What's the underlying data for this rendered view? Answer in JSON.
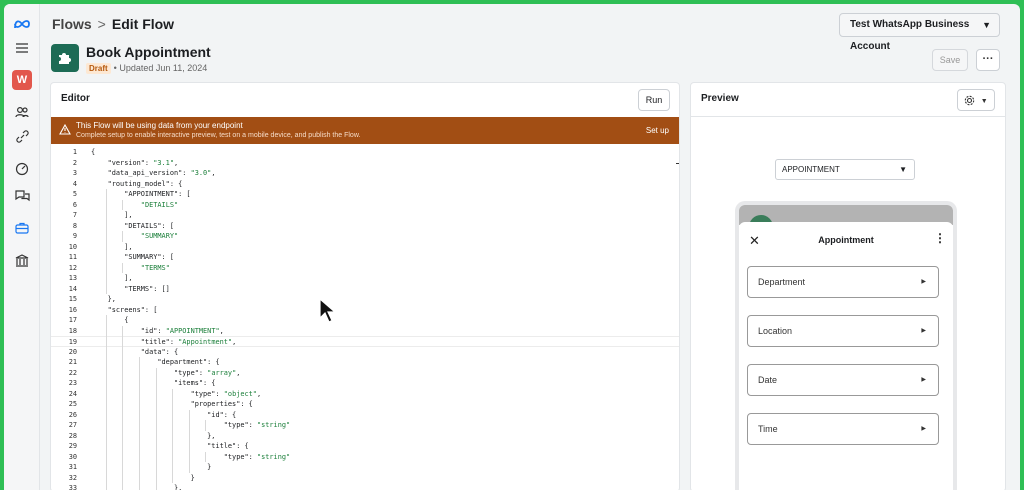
{
  "breadcrumb": {
    "first": "Flows",
    "separator": ">",
    "current": "Edit Flow"
  },
  "account": {
    "label": "Test WhatsApp Business Account"
  },
  "flow": {
    "name": "Book Appointment",
    "status": "Draft",
    "updated": "• Updated Jun 11, 2024"
  },
  "toolbar": {
    "save_label": "Save",
    "more_label": "···"
  },
  "nav": {
    "avatar_letter": "W",
    "icons": [
      "meta-logo-icon",
      "menu-icon",
      "users-icon",
      "link-icon",
      "dashboard-icon",
      "chat-icon",
      "briefcase-icon",
      "bank-icon"
    ]
  },
  "editor": {
    "title": "Editor",
    "run_label": "Run",
    "banner": {
      "headline": "This Flow will be using data from your endpoint",
      "detail": "Complete setup to enable interactive preview, test on a mobile device, and publish the Flow.",
      "action": "Set up"
    },
    "lines": [
      "{",
      "    \"version\": \"3.1\",",
      "    \"data_api_version\": \"3.0\",",
      "    \"routing_model\": {",
      "        \"APPOINTMENT\": [",
      "            \"DETAILS\"",
      "        ],",
      "        \"DETAILS\": [",
      "            \"SUMMARY\"",
      "        ],",
      "        \"SUMMARY\": [",
      "            \"TERMS\"",
      "        ],",
      "        \"TERMS\": []",
      "    },",
      "    \"screens\": [",
      "        {",
      "            \"id\": \"APPOINTMENT\",",
      "            \"title\": \"Appointment\",",
      "            \"data\": {",
      "                \"department\": {",
      "                    \"type\": \"array\",",
      "                    \"items\": {",
      "                        \"type\": \"object\",",
      "                        \"properties\": {",
      "                            \"id\": {",
      "                                \"type\": \"string\"",
      "                            },",
      "                            \"title\": {",
      "                                \"type\": \"string\"",
      "                            }",
      "                        }",
      "                    },"
    ]
  },
  "preview": {
    "title": "Preview",
    "settings_icon": "gear-icon",
    "screen_selected": "APPOINTMENT",
    "phone": {
      "screen_title": "Appointment",
      "fields": [
        "Department",
        "Location",
        "Date",
        "Time"
      ]
    }
  },
  "colors": {
    "banner": "#a24e14",
    "frame": "#2fbf55",
    "string": "#1b7f3a"
  }
}
